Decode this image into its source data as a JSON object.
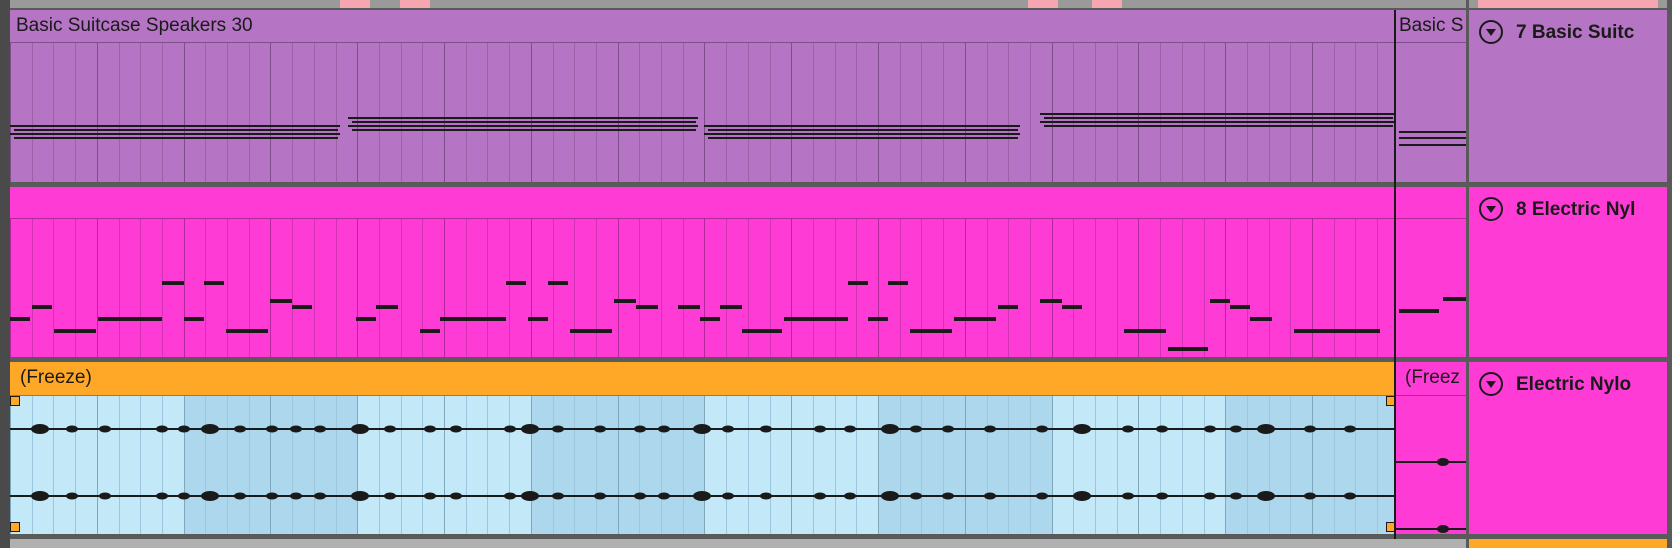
{
  "tracks": [
    {
      "id": "basic-suitcase",
      "name": "7 Basic Suitc",
      "color": "#b574c4"
    },
    {
      "id": "electric-nylon",
      "name": "8 Electric Nyl",
      "color": "#ff3bd6"
    },
    {
      "id": "electric-nylon-freeze",
      "name": "Electric Nylo",
      "color": "#ff3bd6"
    }
  ],
  "clips": {
    "suitcase_main": "Basic Suitcase Speakers 30",
    "suitcase_next": "Basic S",
    "freeze_main": "(Freeze)",
    "freeze_next": "(Freez"
  },
  "colors": {
    "purple": "#b574c4",
    "magenta": "#ff3bd6",
    "orange": "#ffa726",
    "audio_light": "#c3e8f8",
    "audio_dark": "#acd7ec"
  }
}
